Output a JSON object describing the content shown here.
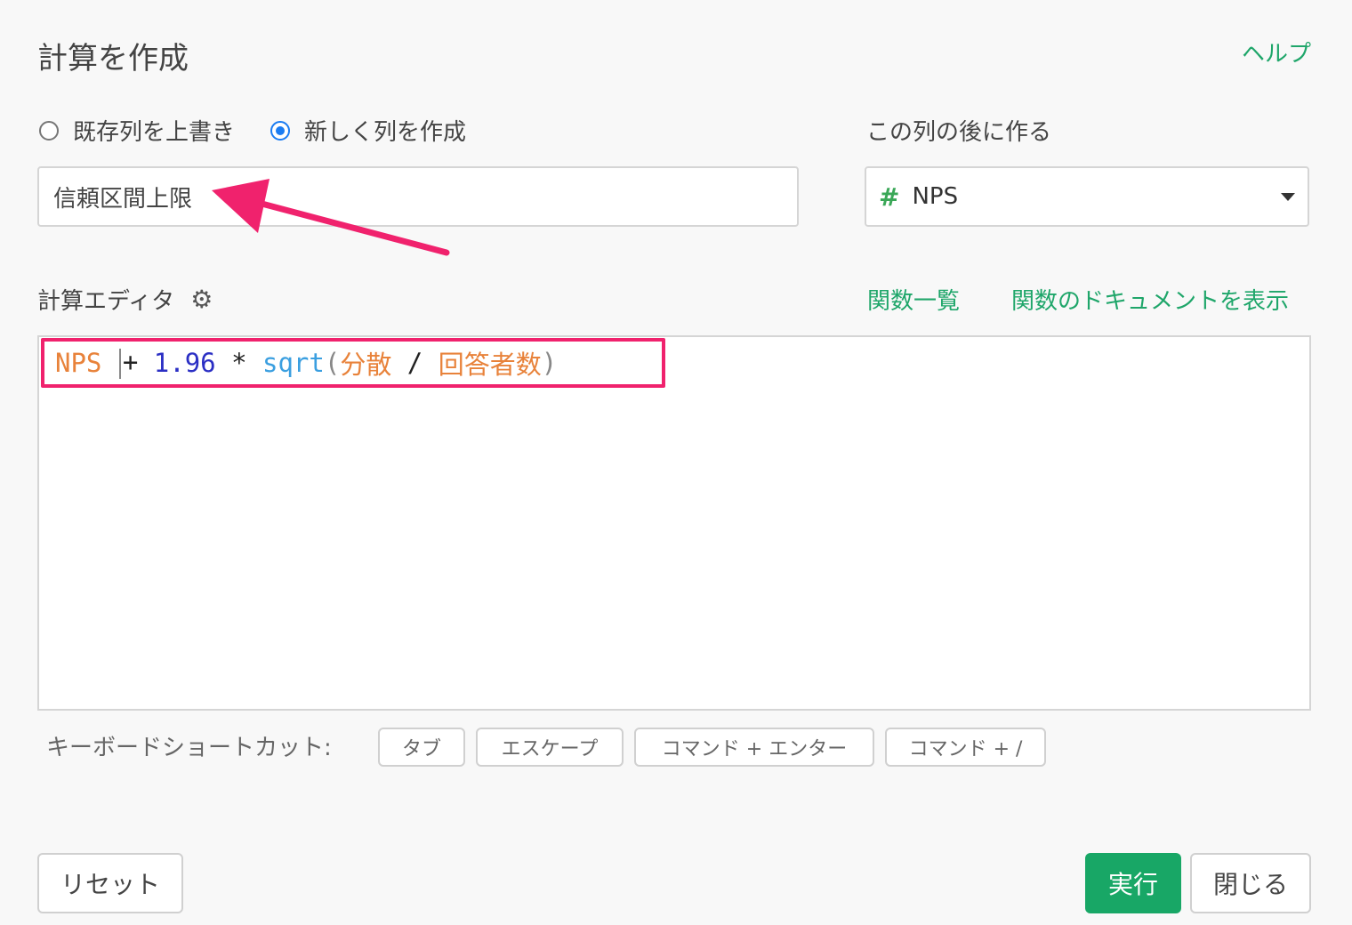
{
  "dialog": {
    "title": "計算を作成",
    "help_link": "ヘルプ"
  },
  "mode": {
    "options": [
      "既存列を上書き",
      "新しく列を作成"
    ],
    "selected_index": 1
  },
  "column_name": {
    "value": "信頼区間上限"
  },
  "position": {
    "label": "この列の後に作る",
    "selected_column": "NPS",
    "column_type_icon": "#"
  },
  "editor": {
    "label": "計算エディタ",
    "settings_icon": "gear-icon",
    "function_list_link": "関数一覧",
    "function_docs_link": "関数のドキュメントを表示",
    "code_tokens": [
      {
        "text": "NPS",
        "type": "field"
      },
      {
        "text": " + ",
        "type": "op"
      },
      {
        "text": "1.96",
        "type": "num"
      },
      {
        "text": " * ",
        "type": "op"
      },
      {
        "text": "sqrt",
        "type": "fn"
      },
      {
        "text": "(",
        "type": "paren"
      },
      {
        "text": "分散",
        "type": "field"
      },
      {
        "text": " / ",
        "type": "op"
      },
      {
        "text": "回答者数",
        "type": "field"
      },
      {
        "text": ")",
        "type": "paren"
      }
    ]
  },
  "shortcuts": {
    "label": "キーボードショートカット:",
    "keys": [
      "タブ",
      "エスケープ",
      "コマンド + エンター",
      "コマンド + /"
    ]
  },
  "buttons": {
    "reset": "リセット",
    "run": "実行",
    "close": "閉じる"
  },
  "colors": {
    "accent_green": "#18a766",
    "annotation_pink": "#f0226d",
    "radio_blue": "#1a7cf2"
  }
}
